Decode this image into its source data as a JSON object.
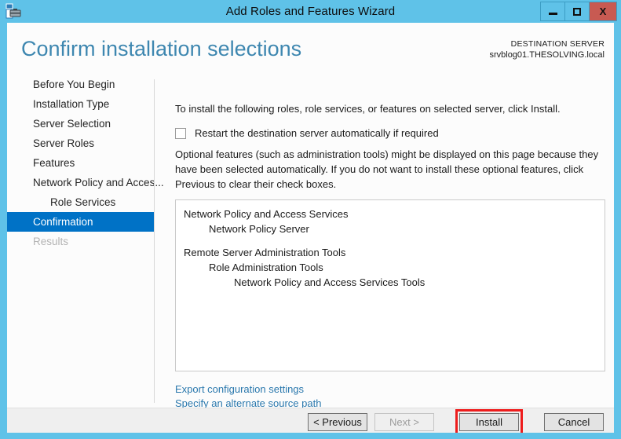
{
  "window": {
    "title": "Add Roles and Features Wizard",
    "icon": "server-wizard-icon",
    "controls": {
      "minimize": "minimize-icon",
      "maximize": "maximize-icon",
      "close": "X"
    }
  },
  "header": {
    "page_title": "Confirm installation selections",
    "destination_label": "DESTINATION SERVER",
    "destination_server": "srvblog01.THESOLVING.local"
  },
  "sidebar": {
    "items": [
      {
        "label": "Before You Begin",
        "state": "normal",
        "level": 0
      },
      {
        "label": "Installation Type",
        "state": "normal",
        "level": 0
      },
      {
        "label": "Server Selection",
        "state": "normal",
        "level": 0
      },
      {
        "label": "Server Roles",
        "state": "normal",
        "level": 0
      },
      {
        "label": "Features",
        "state": "normal",
        "level": 0
      },
      {
        "label": "Network Policy and Acces...",
        "state": "normal",
        "level": 0
      },
      {
        "label": "Role Services",
        "state": "normal",
        "level": 1
      },
      {
        "label": "Confirmation",
        "state": "active",
        "level": 0
      },
      {
        "label": "Results",
        "state": "disabled",
        "level": 0
      }
    ]
  },
  "content": {
    "intro": "To install the following roles, role services, or features on selected server, click Install.",
    "restart_checkbox": {
      "label": "Restart the destination server automatically if required",
      "checked": false
    },
    "optional_note": "Optional features (such as administration tools) might be displayed on this page because they have been selected automatically. If you do not want to install these optional features, click Previous to clear their check boxes.",
    "selection_list": [
      {
        "label": "Network Policy and Access Services",
        "level": 0
      },
      {
        "label": "Network Policy Server",
        "level": 1
      },
      {
        "label": "Remote Server Administration Tools",
        "level": 0,
        "spacer_before": true
      },
      {
        "label": "Role Administration Tools",
        "level": 1
      },
      {
        "label": "Network Policy and Access Services Tools",
        "level": 2
      }
    ],
    "links": [
      "Export configuration settings",
      "Specify an alternate source path"
    ]
  },
  "footer": {
    "buttons": [
      {
        "label": "< Previous",
        "state": "normal"
      },
      {
        "label": "Next >",
        "state": "disabled"
      },
      {
        "label": "Install",
        "state": "highlighted"
      },
      {
        "label": "Cancel",
        "state": "normal"
      }
    ]
  },
  "colors": {
    "titlebar": "#5fc2e8",
    "accent": "#0072c6",
    "heading": "#3e87b0",
    "link": "#2a78ad",
    "close_button": "#c85a52",
    "highlight": "#ee1c1c"
  }
}
